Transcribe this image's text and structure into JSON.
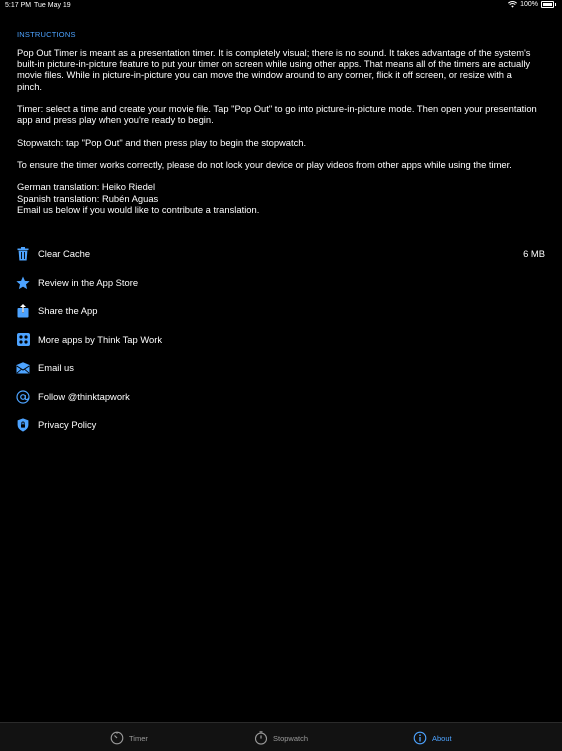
{
  "status_bar": {
    "time": "5:17 PM",
    "date": "Tue May 19",
    "battery": "100%",
    "icons": [
      "wifi-icon",
      "battery-icon"
    ]
  },
  "instructions": {
    "header": "INSTRUCTIONS",
    "paragraphs": [
      [
        "Pop Out Timer is meant as a presentation timer. It is completely visual; there is no sound. It takes advantage of the system's",
        "built-in picture-in-picture feature to put your timer on screen while using other apps. That means all of the timers are actually",
        "movie files. While in picture-in-picture you can move the window around to any corner, flick it off screen, or resize with a",
        "pinch."
      ],
      [
        "Timer: select a time and create your movie file. Tap \"Pop Out\" to go into picture-in-picture mode. Then open your presentation",
        "app and press play when you're ready to begin."
      ],
      [
        "Stopwatch: tap \"Pop Out\" and then press play to begin the stopwatch."
      ],
      [
        "To ensure the timer works correctly, please do not lock your device or play videos from other apps while using the timer."
      ],
      [
        "German translation: Heiko Riedel",
        "Spanish translation: Rubén Aguas",
        "Email us below if you would like to contribute a translation."
      ]
    ]
  },
  "menu": {
    "items": [
      {
        "label": "Clear Cache",
        "value": "6 MB",
        "icon": "trash-icon"
      },
      {
        "label": "Review in the App Store",
        "value": "",
        "icon": "star-icon"
      },
      {
        "label": "Share the App",
        "value": "",
        "icon": "share-icon"
      },
      {
        "label": "More apps by Think Tap Work",
        "value": "",
        "icon": "apps-icon"
      },
      {
        "label": "Email us",
        "value": "",
        "icon": "mail-icon"
      },
      {
        "label": "Follow @thinktapwork",
        "value": "",
        "icon": "at-icon"
      },
      {
        "label": "Privacy Policy",
        "value": "",
        "icon": "privacy-shield-icon"
      }
    ]
  },
  "tabbar": {
    "tabs": [
      {
        "label": "Timer",
        "icon": "timer-icon",
        "active": false
      },
      {
        "label": "Stopwatch",
        "icon": "stopwatch-icon",
        "active": false
      },
      {
        "label": "About",
        "icon": "info-icon",
        "active": true
      }
    ]
  },
  "colors": {
    "accent": "#4da3ff",
    "background": "#000000",
    "text": "#ffffff",
    "tab_inactive": "#9a9a9a"
  }
}
